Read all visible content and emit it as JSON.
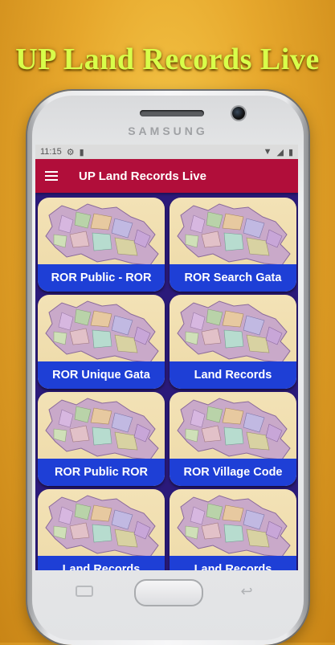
{
  "headline": "UP Land Records Live",
  "phone": {
    "brand": "SAMSUNG"
  },
  "statusbar": {
    "time": "11:15"
  },
  "appbar": {
    "title": "UP Land Records Live"
  },
  "tiles": [
    {
      "label": "ROR Public - ROR"
    },
    {
      "label": "ROR Search Gata"
    },
    {
      "label": "ROR Unique Gata"
    },
    {
      "label": "Land Records"
    },
    {
      "label": "ROR Public ROR"
    },
    {
      "label": "ROR Village Code"
    },
    {
      "label": "Land Records"
    },
    {
      "label": "Land Records"
    }
  ],
  "colors": {
    "appbar": "#b10e3a",
    "tile_label_bg": "#1e3fd6",
    "screen_bg": "#2b1a7a",
    "headline": "#d8ff4a"
  },
  "icons": {
    "menu": "hamburger-menu-icon",
    "settings": "gear-icon",
    "lock": "lock-icon",
    "wifi": "wifi-icon",
    "signal": "signal-icon",
    "battery": "battery-icon",
    "map": "up-map-icon"
  }
}
